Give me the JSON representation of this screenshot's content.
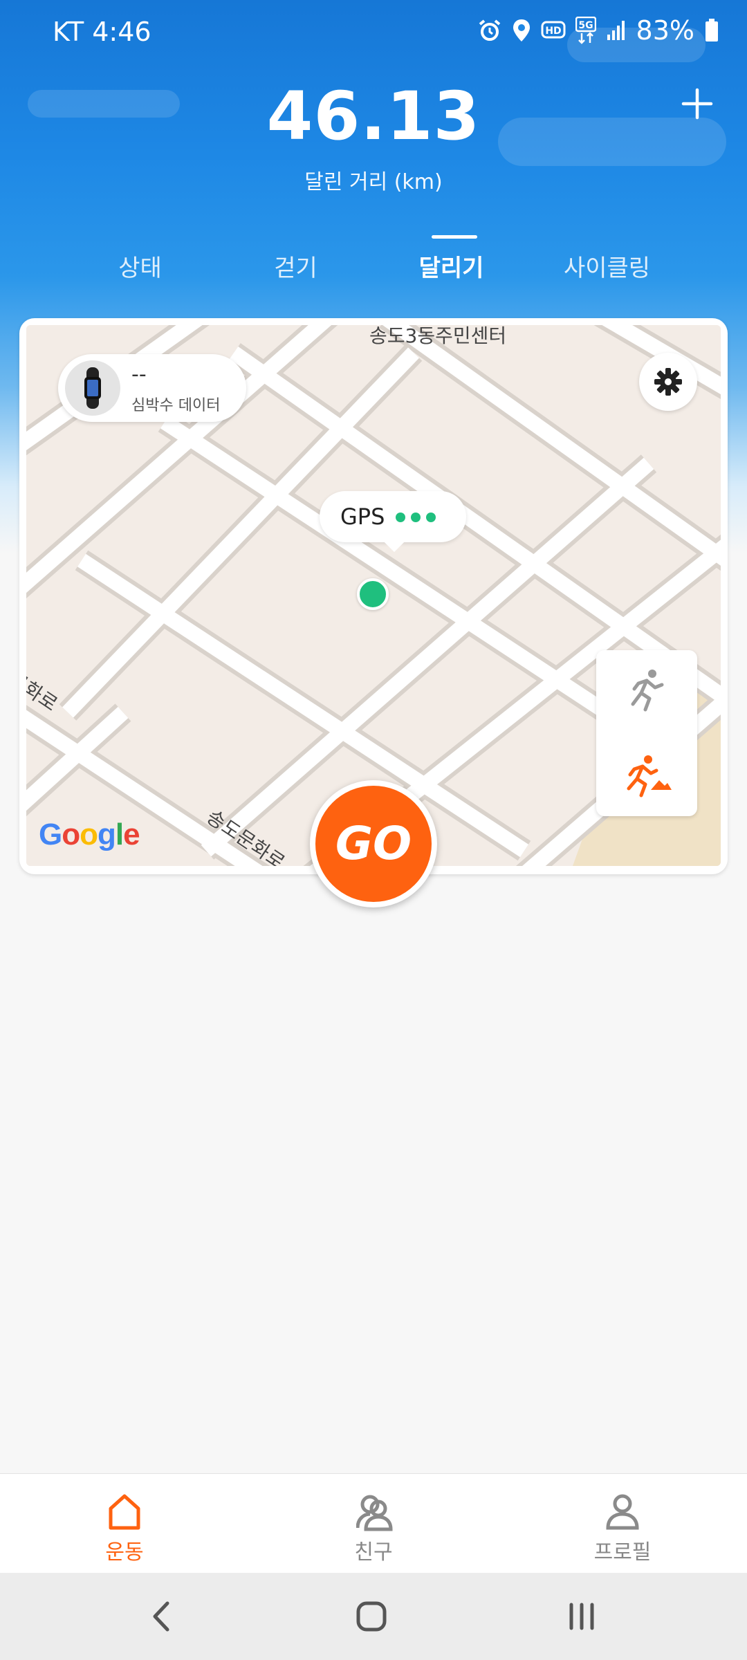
{
  "status_bar": {
    "carrier_time": "KT 4:46",
    "battery": "83%",
    "icons": [
      "alarm-icon",
      "location-icon",
      "hd-icon",
      "5g-icon",
      "signal-icon",
      "battery-icon"
    ]
  },
  "header": {
    "distance_value": "46.13",
    "distance_label": "달린 거리 (km)",
    "add_icon": "plus-icon"
  },
  "tabs": [
    {
      "label": "상태",
      "active": false
    },
    {
      "label": "걷기",
      "active": false
    },
    {
      "label": "달리기",
      "active": true
    },
    {
      "label": "사이클링",
      "active": false
    }
  ],
  "map": {
    "street_labels": [
      "송도3동주민센터",
      "문화로",
      "송도문화로"
    ],
    "heart_rate": {
      "value": "--",
      "label": "심박수 데이터"
    },
    "gps_label": "GPS",
    "attribution": "Google",
    "go_label": "GO",
    "mode_icons": [
      "running-icon",
      "trail-running-icon"
    ]
  },
  "bottom_nav": [
    {
      "label": "운동",
      "icon": "home-icon",
      "active": true
    },
    {
      "label": "친구",
      "icon": "friends-icon",
      "active": false
    },
    {
      "label": "프로필",
      "icon": "profile-icon",
      "active": false
    }
  ],
  "colors": {
    "accent": "#fe6210",
    "gps_green": "#1fbf7e",
    "sky_blue": "#1e88e5"
  }
}
